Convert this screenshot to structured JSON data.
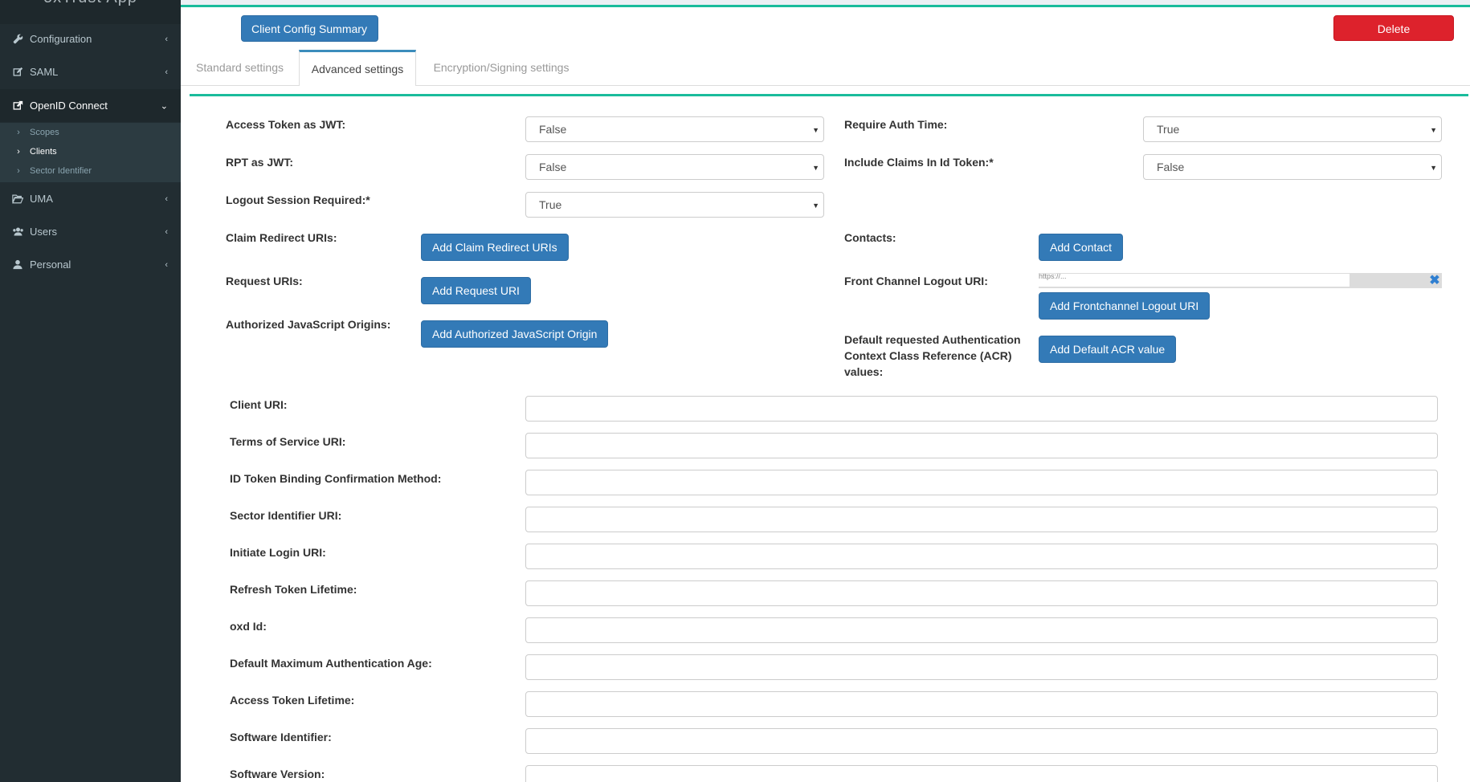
{
  "sidebar": {
    "brand": "oxTrust App",
    "items": [
      {
        "label": "Configuration"
      },
      {
        "label": "SAML"
      },
      {
        "label": "OpenID Connect"
      },
      {
        "label": "UMA"
      },
      {
        "label": "Users"
      },
      {
        "label": "Personal"
      }
    ],
    "sub_items": [
      {
        "label": "Scopes"
      },
      {
        "label": "Clients"
      },
      {
        "label": "Sector Identifier"
      }
    ]
  },
  "header": {
    "summary_button": "Client Config Summary",
    "delete_button": "Delete"
  },
  "tabs": [
    {
      "label": "Standard settings"
    },
    {
      "label": "Advanced settings"
    },
    {
      "label": "Encryption/Signing settings"
    }
  ],
  "form": {
    "access_token_as_jwt": {
      "label": "Access Token as JWT:",
      "value": "False"
    },
    "require_auth_time": {
      "label": "Require Auth Time:",
      "value": "True"
    },
    "rpt_as_jwt": {
      "label": "RPT as JWT:",
      "value": "False"
    },
    "include_claims": {
      "label": "Include Claims In Id Token:*",
      "value": "False"
    },
    "logout_session": {
      "label": "Logout Session Required:*",
      "value": "True"
    },
    "claim_redirect": {
      "label": "Claim Redirect URIs:",
      "button": "Add Claim Redirect URIs"
    },
    "contacts": {
      "label": "Contacts:",
      "button": "Add Contact"
    },
    "request_uris": {
      "label": "Request URIs:",
      "button": "Add Request URI"
    },
    "front_channel": {
      "label": "Front Channel Logout URI:",
      "value": "https://...",
      "button": "Add Frontchannel Logout URI"
    },
    "js_origins": {
      "label": "Authorized JavaScript Origins:",
      "button": "Add Authorized JavaScript Origin"
    },
    "acr": {
      "label_line1": "Default requested Authentication",
      "label_line2": "Context Class Reference (ACR)",
      "label_line3": "values:",
      "button": "Add Default ACR value"
    },
    "text_fields": [
      {
        "label": "Client URI:",
        "value": ""
      },
      {
        "label": "Terms of Service URI:",
        "value": ""
      },
      {
        "label": "ID Token Binding Confirmation Method:",
        "value": ""
      },
      {
        "label": "Sector Identifier URI:",
        "value": ""
      },
      {
        "label": "Initiate Login URI:",
        "value": ""
      },
      {
        "label": "Refresh Token Lifetime:",
        "value": ""
      },
      {
        "label": "oxd Id:",
        "value": ""
      },
      {
        "label": "Default Maximum Authentication Age:",
        "value": ""
      },
      {
        "label": "Access Token Lifetime:",
        "value": ""
      },
      {
        "label": "Software Identifier:",
        "value": ""
      },
      {
        "label": "Software Version:",
        "value": ""
      }
    ]
  }
}
